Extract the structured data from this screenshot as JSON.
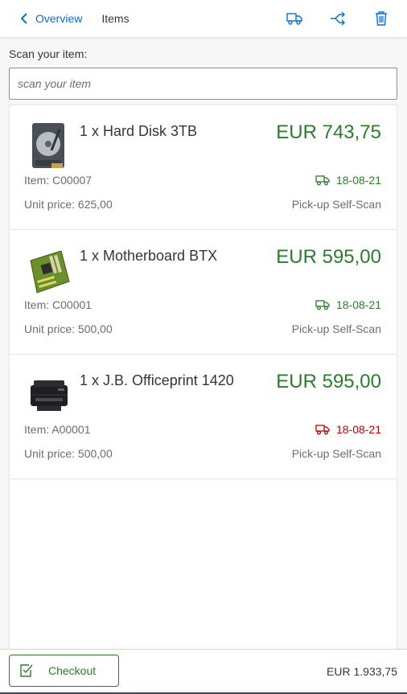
{
  "header": {
    "back_label": "Overview",
    "title": "Items",
    "icons": [
      "truck-icon",
      "split-icon",
      "trash-icon"
    ]
  },
  "scan": {
    "label": "Scan your item:",
    "placeholder": "scan your item"
  },
  "items": [
    {
      "name": "1 x Hard Disk 3TB",
      "price": "EUR 743,75",
      "item_no": "Item: C00007",
      "unit_price": "Unit price: 625,00",
      "date": "18-08-21",
      "date_status": "ok",
      "pickup": "Pick-up Self-Scan",
      "image": "hard-disk-image"
    },
    {
      "name": "1 x Motherboard BTX",
      "price": "EUR 595,00",
      "item_no": "Item: C00001",
      "unit_price": "Unit price: 500,00",
      "date": "18-08-21",
      "date_status": "ok",
      "pickup": "Pick-up Self-Scan",
      "image": "motherboard-image"
    },
    {
      "name": "1 x J.B. Officeprint 1420",
      "price": "EUR 595,00",
      "item_no": "Item: A00001",
      "unit_price": "Unit price: 500,00",
      "date": "18-08-21",
      "date_status": "error",
      "pickup": "Pick-up Self-Scan",
      "image": "printer-image"
    }
  ],
  "footer": {
    "checkout_label": "Checkout",
    "total": "EUR 1.933,75"
  },
  "colors": {
    "accent": "#0a6ed1",
    "positive": "#2b7d2b",
    "negative": "#bb0000"
  }
}
